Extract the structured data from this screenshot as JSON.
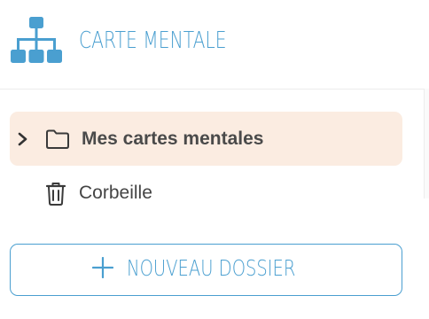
{
  "header": {
    "title": "CARTE MENTALE",
    "logo_icon": "sitemap-icon",
    "accent_color": "#4a9fd0"
  },
  "sidebar": {
    "items": [
      {
        "label": "Mes cartes mentales",
        "icon": "folder-icon",
        "expand_icon": "chevron-right-icon",
        "active": true,
        "highlight_color": "#fbece1"
      },
      {
        "label": "Corbeille",
        "icon": "trash-icon",
        "active": false
      }
    ],
    "new_folder_button": {
      "label": "NOUVEAU DOSSIER",
      "icon": "plus-icon"
    }
  }
}
